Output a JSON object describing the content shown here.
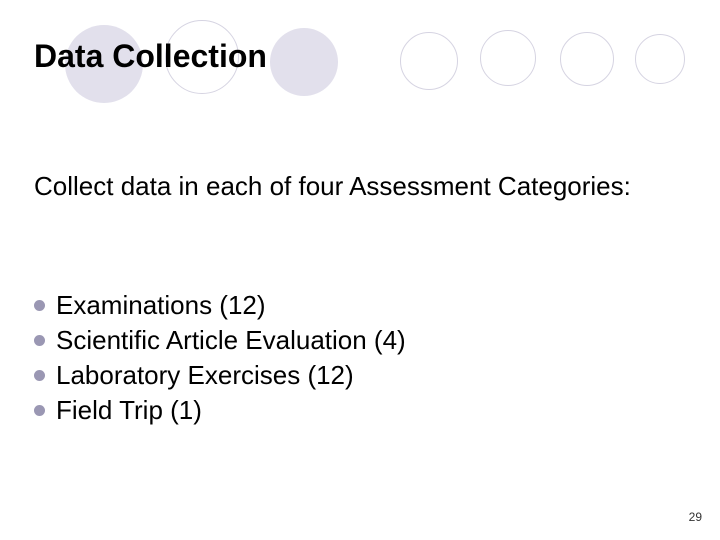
{
  "title": "Data Collection",
  "intro": "Collect data in each of four Assessment Categories:",
  "bullets": [
    "Examinations (12)",
    "Scientific Article Evaluation (4)",
    "Laboratory Exercises (12)",
    "Field Trip (1)"
  ],
  "page_number": "29"
}
